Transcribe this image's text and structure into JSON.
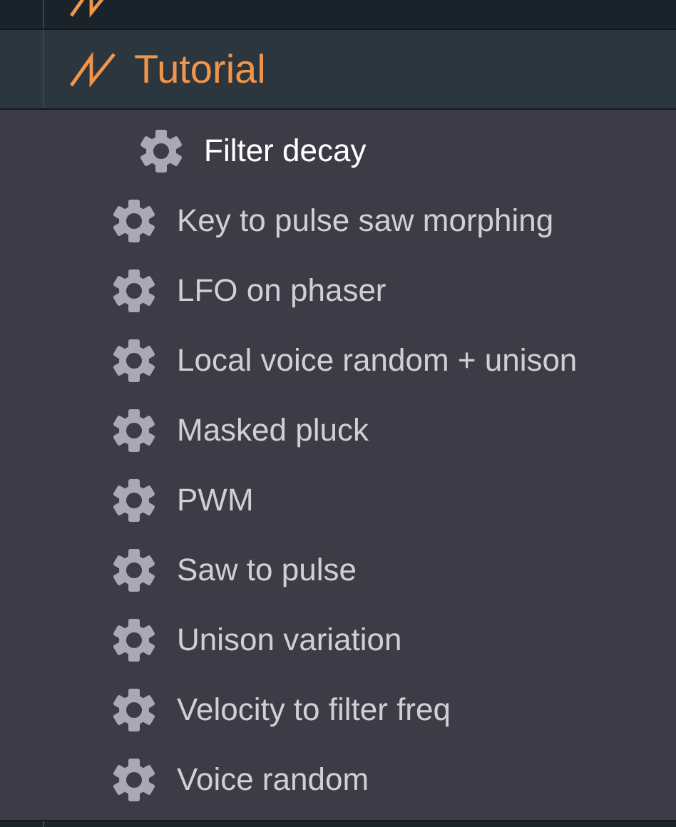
{
  "open_folder": {
    "label": "Tutorial",
    "highlighted": true
  },
  "presets": [
    {
      "label": "Filter decay",
      "selected": true
    },
    {
      "label": "Key to pulse saw morphing",
      "selected": false
    },
    {
      "label": "LFO on phaser",
      "selected": false
    },
    {
      "label": "Local voice random + unison",
      "selected": false
    },
    {
      "label": "Masked pluck",
      "selected": false
    },
    {
      "label": "PWM",
      "selected": false
    },
    {
      "label": "Saw to pulse",
      "selected": false
    },
    {
      "label": "Unison variation",
      "selected": false
    },
    {
      "label": "Velocity to filter freq",
      "selected": false
    },
    {
      "label": "Voice random",
      "selected": false
    }
  ]
}
